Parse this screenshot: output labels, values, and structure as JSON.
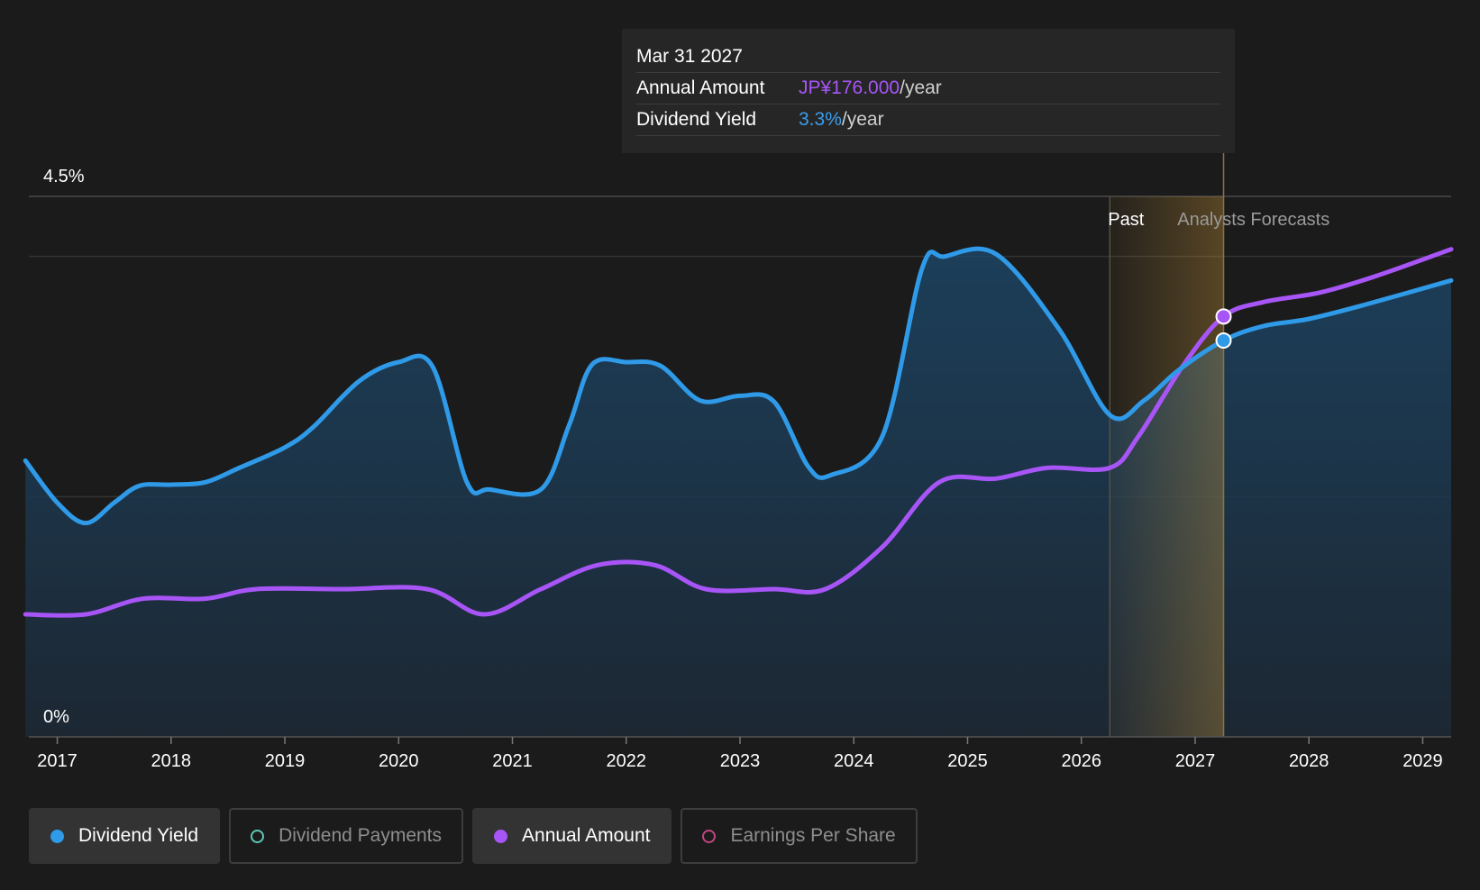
{
  "tooltip": {
    "date": "Mar 31 2027",
    "rows": [
      {
        "label": "Annual Amount",
        "value": "JP¥176.000",
        "unit": "/year",
        "color": "#a855f7"
      },
      {
        "label": "Dividend Yield",
        "value": "3.3%",
        "unit": "/year",
        "color": "#3b9ded"
      }
    ]
  },
  "legend": [
    {
      "label": "Dividend Yield",
      "color": "#2f9ae8",
      "active": true,
      "filled": true
    },
    {
      "label": "Dividend Payments",
      "color": "#5ec9b5",
      "active": false,
      "filled": false
    },
    {
      "label": "Annual Amount",
      "color": "#a855f7",
      "active": true,
      "filled": true
    },
    {
      "label": "Earnings Per Share",
      "color": "#c2457f",
      "active": false,
      "filled": false
    }
  ],
  "chart_data": {
    "type": "line",
    "y_axis": {
      "labels": [
        "4.5%",
        "0%"
      ],
      "range": [
        0,
        4.5
      ],
      "unit": "%"
    },
    "x_axis": {
      "ticks": [
        "2017",
        "2018",
        "2019",
        "2020",
        "2021",
        "2022",
        "2023",
        "2024",
        "2025",
        "2026",
        "2027",
        "2028",
        "2029"
      ],
      "range": [
        2016.75,
        2029.25
      ]
    },
    "regions": {
      "past_label": "Past",
      "forecast_label": "Analysts Forecasts",
      "past_end": 2026.25,
      "highlight_end": 2027.25
    },
    "series": [
      {
        "name": "Dividend Yield",
        "color": "#2f9ae8",
        "area": true,
        "points": [
          [
            2016.72,
            2.3
          ],
          [
            2017.0,
            1.95
          ],
          [
            2017.25,
            1.78
          ],
          [
            2017.5,
            1.95
          ],
          [
            2017.72,
            2.09
          ],
          [
            2018.0,
            2.1
          ],
          [
            2018.3,
            2.12
          ],
          [
            2018.6,
            2.24
          ],
          [
            2019.0,
            2.41
          ],
          [
            2019.25,
            2.58
          ],
          [
            2019.65,
            2.96
          ],
          [
            2020.0,
            3.12
          ],
          [
            2020.3,
            3.08
          ],
          [
            2020.6,
            2.12
          ],
          [
            2020.8,
            2.06
          ],
          [
            2021.25,
            2.06
          ],
          [
            2021.5,
            2.6
          ],
          [
            2021.7,
            3.1
          ],
          [
            2022.0,
            3.12
          ],
          [
            2022.3,
            3.09
          ],
          [
            2022.65,
            2.8
          ],
          [
            2023.0,
            2.84
          ],
          [
            2023.3,
            2.79
          ],
          [
            2023.6,
            2.25
          ],
          [
            2023.8,
            2.18
          ],
          [
            2024.25,
            2.5
          ],
          [
            2024.6,
            3.9
          ],
          [
            2024.8,
            4.0
          ],
          [
            2025.25,
            4.02
          ],
          [
            2025.8,
            3.4
          ],
          [
            2026.25,
            2.68
          ],
          [
            2026.55,
            2.8
          ],
          [
            2026.85,
            3.05
          ],
          [
            2027.25,
            3.3
          ],
          [
            2027.6,
            3.42
          ],
          [
            2028.0,
            3.48
          ],
          [
            2028.5,
            3.6
          ],
          [
            2029.25,
            3.8
          ]
        ]
      },
      {
        "name": "Annual Amount",
        "color": "#a855f7",
        "area": false,
        "points": [
          [
            2016.72,
            1.02
          ],
          [
            2017.25,
            1.02
          ],
          [
            2017.75,
            1.15
          ],
          [
            2018.3,
            1.15
          ],
          [
            2018.75,
            1.23
          ],
          [
            2019.5,
            1.23
          ],
          [
            2020.25,
            1.23
          ],
          [
            2020.75,
            1.02
          ],
          [
            2021.25,
            1.23
          ],
          [
            2021.75,
            1.43
          ],
          [
            2022.25,
            1.43
          ],
          [
            2022.7,
            1.23
          ],
          [
            2023.3,
            1.23
          ],
          [
            2023.75,
            1.23
          ],
          [
            2024.25,
            1.58
          ],
          [
            2024.75,
            2.12
          ],
          [
            2025.25,
            2.15
          ],
          [
            2025.7,
            2.24
          ],
          [
            2026.25,
            2.24
          ],
          [
            2026.5,
            2.5
          ],
          [
            2026.9,
            3.1
          ],
          [
            2027.25,
            3.5
          ],
          [
            2027.6,
            3.62
          ],
          [
            2028.1,
            3.7
          ],
          [
            2028.6,
            3.84
          ],
          [
            2029.25,
            4.06
          ]
        ]
      }
    ],
    "highlight": {
      "x": 2027.25,
      "values": {
        "Annual Amount": 3.5,
        "Dividend Yield": 3.3
      }
    }
  }
}
